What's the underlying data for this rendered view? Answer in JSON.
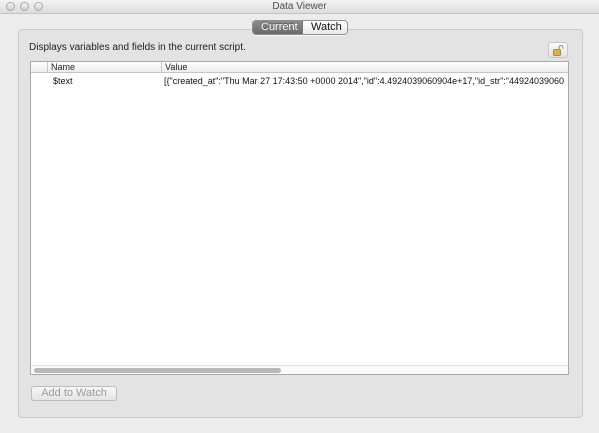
{
  "window": {
    "title": "Data Viewer"
  },
  "tabs": [
    {
      "label": "Current",
      "selected": true
    },
    {
      "label": "Watch",
      "selected": false
    }
  ],
  "description": "Displays variables and fields in the current script.",
  "icons": {
    "lock": "lock-icon"
  },
  "table": {
    "columns": [
      "",
      "Name",
      "Value"
    ],
    "rows": [
      {
        "name": "$text",
        "value": "[{\"created_at\":\"Thu Mar 27 17:43:50 +0000 2014\",\"id\":4.4924039060904e+17,\"id_str\":\"44924039060"
      }
    ]
  },
  "buttons": {
    "add_to_watch": "Add to Watch"
  }
}
